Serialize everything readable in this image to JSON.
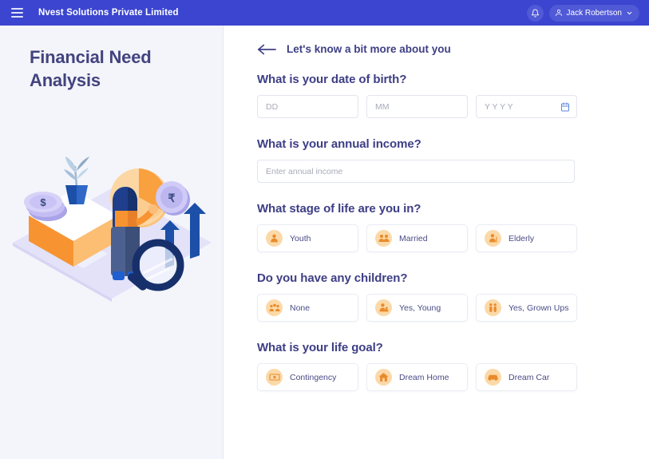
{
  "header": {
    "menu_icon": "hamburger-icon",
    "brand_title": "Nvest Solutions Private Limited",
    "bell_icon": "bell-icon",
    "user_icon": "person-icon",
    "user_name": "Jack Robertson",
    "chevron_icon": "chevron-down-icon",
    "background_color": "#3b45cf"
  },
  "sidebar": {
    "title": "Financial Need Analysis",
    "illustration_name": "financial-analysis-illustration",
    "background_color": "#f3f5fa",
    "title_color": "#43437f"
  },
  "form": {
    "back_icon": "back-arrow-icon",
    "subtitle": "Let's know a bit more about you",
    "sections": [
      {
        "id": "date-of-birth",
        "title": "What is your date of birth?",
        "type": "date-inputs",
        "inputs": [
          {
            "name": "day",
            "value": "",
            "placeholder": "DD"
          },
          {
            "name": "month",
            "value": "",
            "placeholder": "MM"
          },
          {
            "name": "year",
            "value": "",
            "placeholder": "Y Y Y Y",
            "icon": "calendar-icon"
          }
        ]
      },
      {
        "id": "annual-income",
        "title": "What is your annual income?",
        "type": "text-input",
        "input": {
          "name": "annual-income",
          "value": "",
          "placeholder": "Enter annual income"
        }
      },
      {
        "id": "stage-of-life",
        "title": "What stage of life are you in?",
        "type": "options",
        "options": [
          {
            "label": "Youth",
            "icon": "youth-icon"
          },
          {
            "label": "Married",
            "icon": "married-icon"
          },
          {
            "label": "Elderly",
            "icon": "elderly-icon"
          }
        ]
      },
      {
        "id": "children",
        "title": "Do you have any children?",
        "type": "options",
        "options": [
          {
            "label": "None",
            "icon": "no-children-icon"
          },
          {
            "label": "Yes, Young",
            "icon": "young-child-icon"
          },
          {
            "label": "Yes, Grown Ups",
            "icon": "grown-children-icon"
          }
        ]
      },
      {
        "id": "life-goal",
        "title": "What is your life goal?",
        "type": "options",
        "options": [
          {
            "label": "Contingency",
            "icon": "banknote-icon"
          },
          {
            "label": "Dream Home",
            "icon": "house-icon"
          },
          {
            "label": "Dream Car",
            "icon": "car-icon"
          }
        ]
      }
    ],
    "option_icon_bg": "#fbd9a8",
    "heading_color": "#3d3e85"
  }
}
